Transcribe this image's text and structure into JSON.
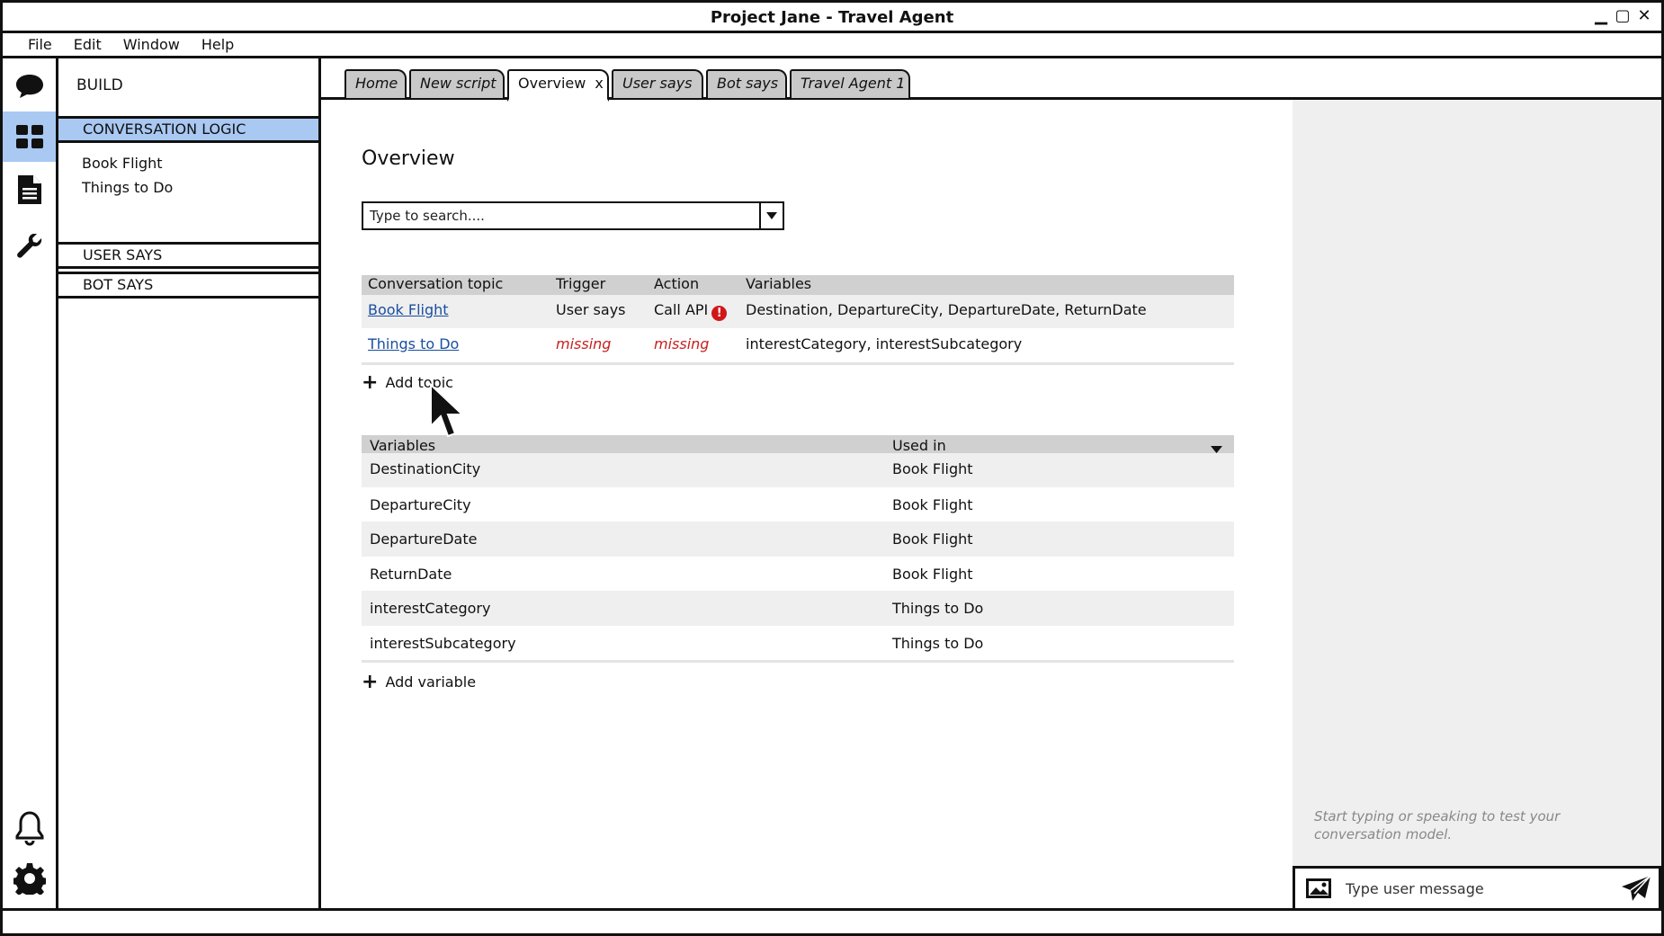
{
  "window": {
    "title": "Project Jane - Travel Agent",
    "controls": [
      "▁",
      "▢",
      "✕"
    ]
  },
  "menu": [
    "File",
    "Edit",
    "Window",
    "Help"
  ],
  "rail": {
    "top_icons": [
      "chat-bubble-icon",
      "dashboard-grid-icon",
      "document-icon",
      "wrench-icon"
    ],
    "bottom_icons": [
      "bell-icon",
      "settings-gear-icon"
    ],
    "active": "dashboard-grid-icon",
    "active_color": "#a9c8f2"
  },
  "sidepanel": {
    "header": "BUILD",
    "sections": [
      {
        "label": "CONVERSATION LOGIC",
        "selected": true,
        "items": [
          "Book Flight",
          "Things to Do"
        ]
      },
      {
        "label": "USER SAYS",
        "selected": false
      },
      {
        "label": "BOT SAYS",
        "selected": false
      }
    ]
  },
  "tabs": [
    {
      "label": "Home",
      "active": false
    },
    {
      "label": "New script",
      "active": false
    },
    {
      "label": "Overview",
      "active": true,
      "close": "x"
    },
    {
      "label": "User says",
      "active": false
    },
    {
      "label": "Bot says",
      "active": false
    },
    {
      "label": "Travel Agent 1",
      "active": false
    }
  ],
  "main": {
    "title": "Overview",
    "search_placeholder": "Type to search....",
    "topics_table": {
      "headers": [
        "Conversation topic",
        "Trigger",
        "Action",
        "Variables"
      ],
      "rows": [
        {
          "topic": "Book Flight",
          "trigger": "User says",
          "trigger_missing": false,
          "action": "Call API",
          "action_missing": false,
          "action_error": "!",
          "variables": "Destination, DepartureCity, DepartureDate, ReturnDate"
        },
        {
          "topic": "Things to Do",
          "trigger": "missing",
          "trigger_missing": true,
          "action": "missing",
          "action_missing": true,
          "action_error": "",
          "variables": "interestCategory, interestSubcategory"
        }
      ]
    },
    "add_topic": "Add topic",
    "variables_table": {
      "headers": [
        "Variables",
        "Used in"
      ],
      "rows": [
        {
          "name": "DestinationCity",
          "used_in": "Book Flight"
        },
        {
          "name": "DepartureCity",
          "used_in": "Book Flight"
        },
        {
          "name": "DepartureDate",
          "used_in": "Book Flight"
        },
        {
          "name": "ReturnDate",
          "used_in": "Book Flight"
        },
        {
          "name": "interestCategory",
          "used_in": "Things to Do"
        },
        {
          "name": "interestSubcategory",
          "used_in": "Things to Do"
        }
      ]
    },
    "add_variable": "Add variable",
    "error_color": "#d01818",
    "link_color": "#1a4fa0"
  },
  "chat": {
    "hint": "Start typing or speaking to test your conversation model.",
    "input_placeholder": "Type user message"
  }
}
